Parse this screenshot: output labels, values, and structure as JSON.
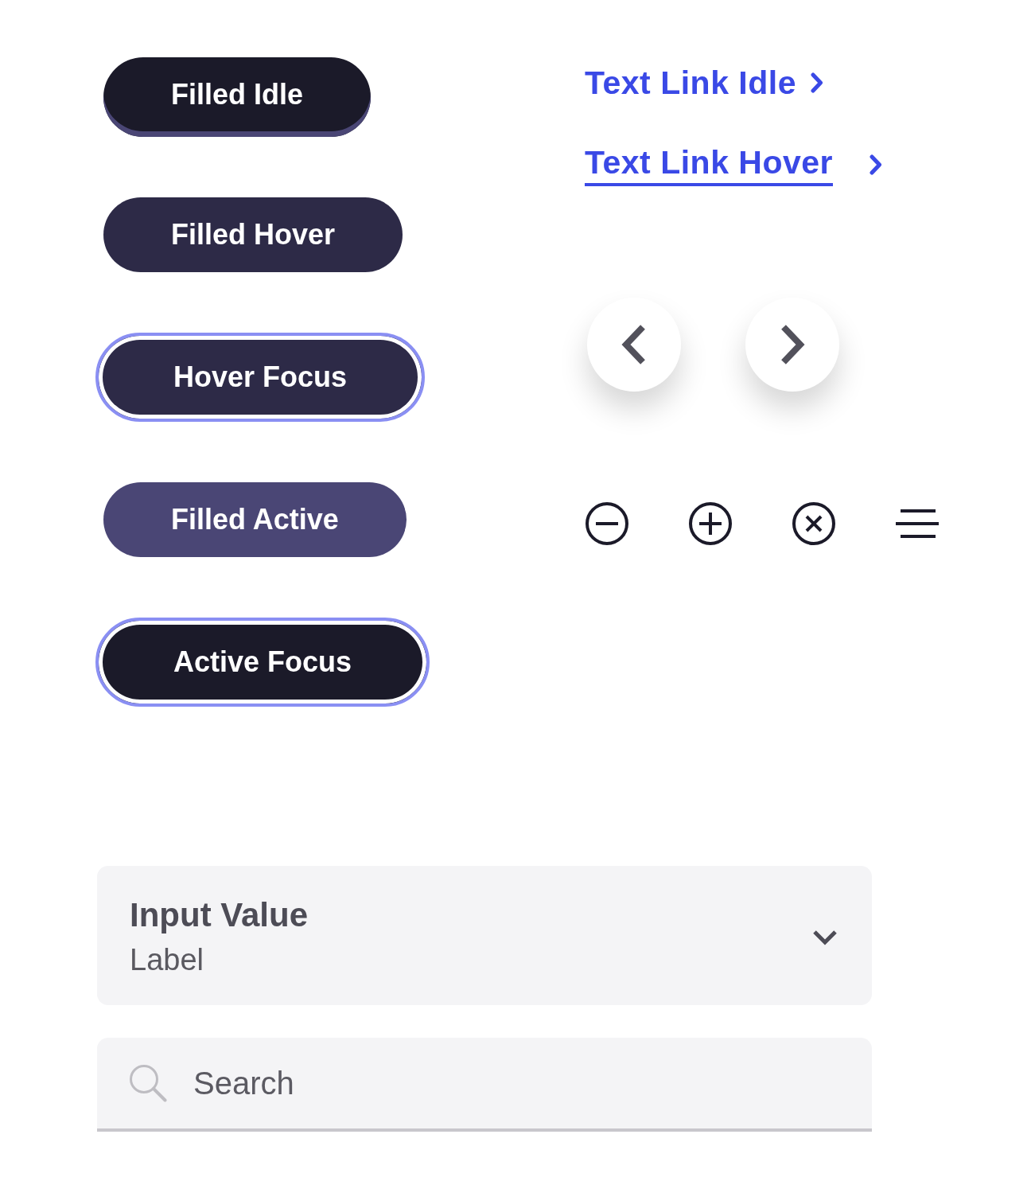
{
  "buttons": [
    {
      "label": "Filled Idle",
      "hovered": false,
      "active": false,
      "focused": false
    },
    {
      "label": "Filled Hover",
      "hovered": true,
      "active": false,
      "focused": false
    },
    {
      "label": "Hover Focus",
      "hovered": true,
      "active": false,
      "focused": true
    },
    {
      "label": "Filled Active",
      "hovered": false,
      "active": true,
      "focused": false
    },
    {
      "label": "Active Focus",
      "hovered": false,
      "active": true,
      "focused": true
    }
  ],
  "links": [
    {
      "label": "Text Link Idle",
      "hovered": false
    },
    {
      "label": "Text Link Hover",
      "hovered": true
    }
  ],
  "select": {
    "value": "Input Value",
    "label": "Label"
  },
  "search": {
    "placeholder": "Search"
  }
}
